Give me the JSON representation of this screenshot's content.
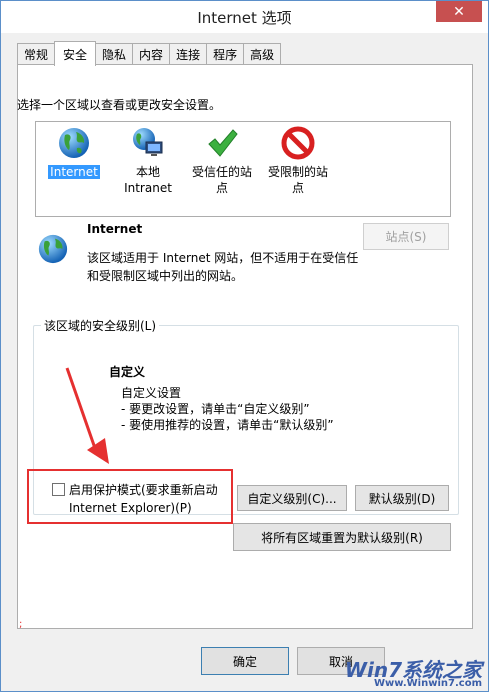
{
  "window": {
    "title": "Internet 选项",
    "close_glyph": "✕"
  },
  "tabs": [
    {
      "label": "常规",
      "active": false
    },
    {
      "label": "安全",
      "active": true
    },
    {
      "label": "隐私",
      "active": false
    },
    {
      "label": "内容",
      "active": false
    },
    {
      "label": "连接",
      "active": false
    },
    {
      "label": "程序",
      "active": false
    },
    {
      "label": "高级",
      "active": false
    }
  ],
  "security": {
    "prompt": "选择一个区域以查看或更改安全设置。",
    "zones": [
      {
        "line1": "Internet",
        "line2": "",
        "icon": "globe-icon",
        "selected": true
      },
      {
        "line1": "本地",
        "line2": "Intranet",
        "icon": "intranet-icon",
        "selected": false
      },
      {
        "line1": "受信任的站",
        "line2": "点",
        "icon": "checkmark-icon",
        "selected": false
      },
      {
        "line1": "受限制的站",
        "line2": "点",
        "icon": "restricted-icon",
        "selected": false
      }
    ],
    "zone_info": {
      "title": "Internet",
      "desc_line1": "该区域适用于 Internet 网站，但不适用于在受信任",
      "desc_line2": "和受限制区域中列出的网站。",
      "sites_button": "站点(S)"
    },
    "level_group": {
      "label": "该区域的安全级别(L)",
      "level_title": "自定义",
      "desc_line1": "自定义设置",
      "desc_line2": "- 要更改设置，请单击“自定义级别”",
      "desc_line3": "- 要使用推荐的设置，请单击“默认级别”"
    },
    "protected_mode": {
      "line1": "启用保护模式(要求重新启动",
      "line2": "Internet Explorer)(P)",
      "checked": false
    },
    "custom_level_button": "自定义级别(C)...",
    "default_level_button": "默认级别(D)",
    "reset_all_button": "将所有区域重置为默认级别(R)"
  },
  "footer": {
    "ok": "确定",
    "cancel": "取消"
  },
  "watermark": {
    "text": "Win7系统之家",
    "url": "Www.Winwin7.com"
  },
  "colors": {
    "accent": "#3399ff",
    "highlight_border": "#e53030",
    "close": "#c75050"
  }
}
